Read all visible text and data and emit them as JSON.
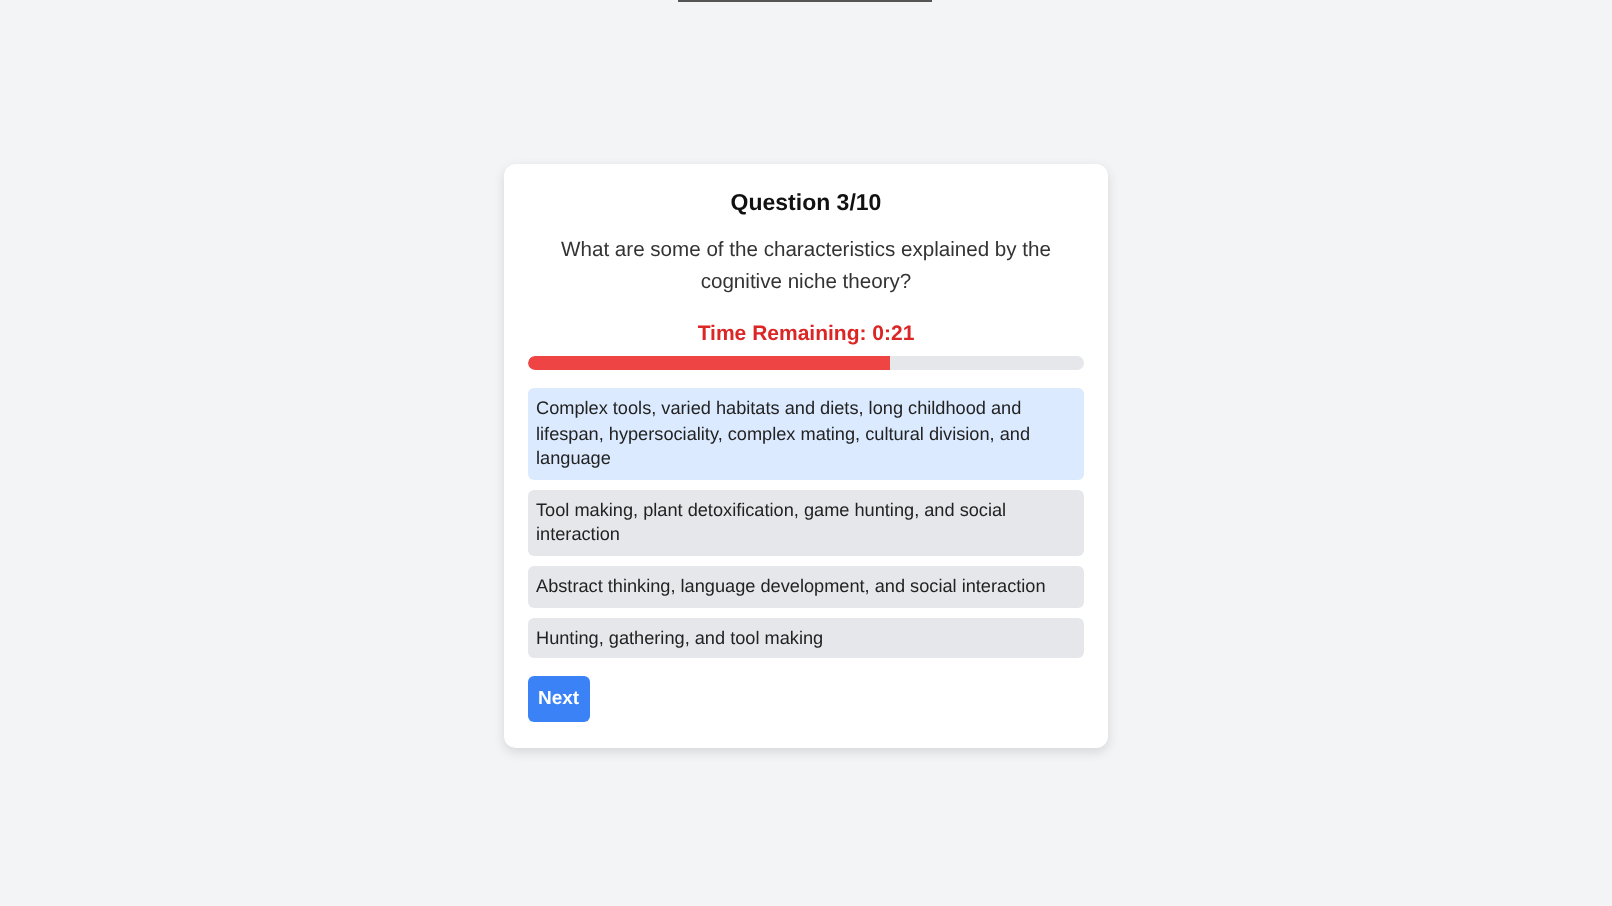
{
  "quiz": {
    "title": "Question 3/10",
    "question": "What are some of the characteristics explained by the cognitive niche theory?",
    "timer": "Time Remaining: 0:21",
    "time_progress": {
      "level": 0.65
    },
    "options": [
      {
        "text": "Complex tools, varied habitats and diets, long childhood and lifespan, hypersociality, complex mating, cultural division, and language",
        "selected": true
      },
      {
        "text": "Tool making, plant detoxification, game hunting, and social interaction",
        "selected": false
      },
      {
        "text": "Abstract thinking, language development, and social interaction",
        "selected": false
      },
      {
        "text": "Hunting, gathering, and tool making",
        "selected": false
      }
    ],
    "next_button": "Next"
  }
}
